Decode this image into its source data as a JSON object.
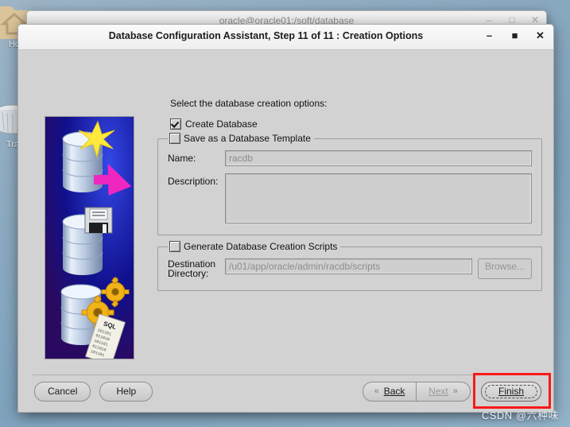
{
  "desktop": {
    "icons": [
      {
        "name": "Home",
        "label": "Ho",
        "icon": "home-folder-icon"
      },
      {
        "name": "Trash",
        "label": "Tra",
        "icon": "trash-can-icon"
      }
    ],
    "watermark": "CSDN @六种味",
    "background_color": "#8aa9c0"
  },
  "terminal_window": {
    "title": "oracle@oracle01:/soft/database",
    "controls": {
      "minimize": "–",
      "maximize": "□",
      "close": "✕"
    }
  },
  "dialog": {
    "title": "Database Configuration Assistant, Step 11 of 11 : Creation Options",
    "controls": {
      "minimize": "–",
      "maximize": "■",
      "close": "✕"
    },
    "banner_alt": "database-creation-banner",
    "intro": "Select the database creation options:",
    "create_database": {
      "label": "Create Database",
      "checked": true
    },
    "template_group": {
      "label": "Save as a Database Template",
      "checked": false,
      "name_label": "Name:",
      "name_value": "racdb",
      "description_label": "Description:",
      "description_value": ""
    },
    "scripts_group": {
      "label": "Generate Database Creation Scripts",
      "checked": false,
      "destination_label_line1": "Destination",
      "destination_label_line2": "Directory:",
      "destination_value": "/u01/app/oracle/admin/racdb/scripts",
      "browse_label": "Browse..."
    },
    "buttons": {
      "cancel": "Cancel",
      "help": "Help",
      "back": "Back",
      "back_arrow": "«",
      "next": "Next",
      "next_arrow": "»",
      "finish": "Finish"
    },
    "highlight_color": "#fa1818"
  }
}
